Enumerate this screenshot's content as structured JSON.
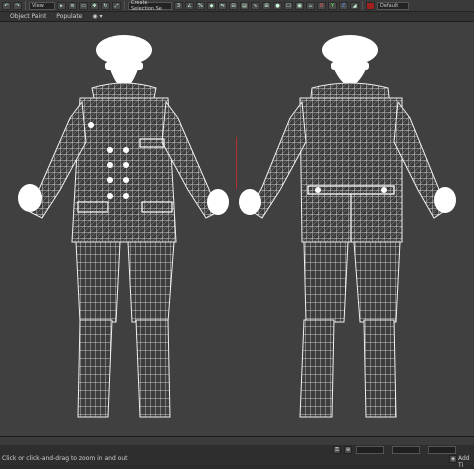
{
  "toolbar": {
    "view_select": "View",
    "selection_set": "Create Selection Se",
    "workspace": "Default",
    "axis_x": "X",
    "axis_y": "Y",
    "axis_z": "Z"
  },
  "ribbon": {
    "tabs": [
      "Object Paint",
      "Populate"
    ]
  },
  "status": {
    "prompt": "Click or click-and-drag to zoom in and out",
    "add_time_tag": "Add Ti"
  },
  "colors": {
    "viewport_bg": "#404040",
    "wire": "#f2f2f2",
    "gizmo": "#b03030"
  }
}
